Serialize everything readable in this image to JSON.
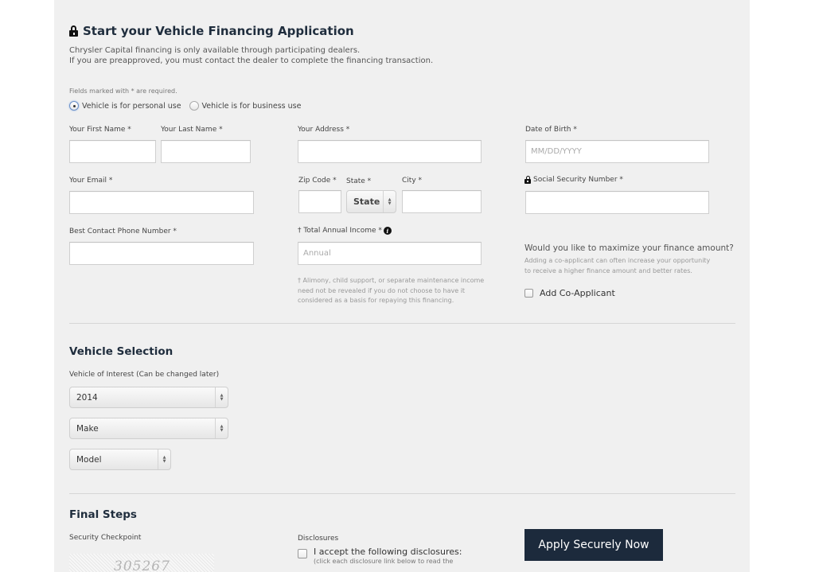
{
  "header": {
    "title": "Start your Vehicle Financing Application",
    "title_icon": "lock-icon",
    "intro_lines": [
      "Chrysler Capital financing is only available through participating dealers.",
      "If you are preapproved, you must contact the dealer to complete the financing transaction."
    ]
  },
  "form": {
    "required_note": "Fields marked with * are required.",
    "use_options": [
      {
        "label": "Vehicle is for personal use",
        "checked": true
      },
      {
        "label": "Vehicle is for business use",
        "checked": false
      }
    ],
    "first_name": {
      "label": "Your First Name *",
      "value": ""
    },
    "last_name": {
      "label": "Your Last Name *",
      "value": ""
    },
    "address": {
      "label": "Your Address *",
      "value": ""
    },
    "dob": {
      "label": "Date of Birth *",
      "placeholder": "MM/DD/YYYY"
    },
    "email": {
      "label": "Your Email *",
      "value": ""
    },
    "zip": {
      "label": "Zip Code *",
      "value": ""
    },
    "state": {
      "label": "State *",
      "selected": "State"
    },
    "city": {
      "label": "City *",
      "value": ""
    },
    "ssn": {
      "label": "Social Security Number *",
      "icon": "lock-icon",
      "value": ""
    },
    "phone": {
      "label": "Best Contact Phone Number *",
      "value": ""
    },
    "income": {
      "label": "† Total Annual Income *",
      "info_icon": "i",
      "placeholder": "Annual",
      "hint_lines": [
        "† Alimony, child support, or separate maintenance income",
        "need not be revealed if you do not choose to have it",
        "considered as a basis for repaying this financing."
      ]
    },
    "coapplicant": {
      "title": "Would you like to maximize your finance amount?",
      "desc_lines": [
        "Adding a co-applicant can often increase your opportunity",
        "to receive a higher finance amount and better rates."
      ],
      "checkbox_label": "Add Co-Applicant",
      "checked": false
    }
  },
  "vehicle": {
    "title": "Vehicle Selection",
    "label": "Vehicle of Interest (Can be changed later)",
    "year": "2014",
    "make": "Make",
    "model": "Model"
  },
  "final": {
    "title": "Final Steps",
    "security_label": "Security Checkpoint",
    "captcha_text": "305267",
    "disclosures_label": "Disclosures",
    "accept_label": "I accept the following disclosures:",
    "accept_sub": "(click each disclosure link below to read the",
    "apply_button": "Apply Securely Now"
  },
  "colors": {
    "panel_bg": "#f0f0f0",
    "heading": "#1f2d3d",
    "button_bg": "#1c2a3c"
  }
}
